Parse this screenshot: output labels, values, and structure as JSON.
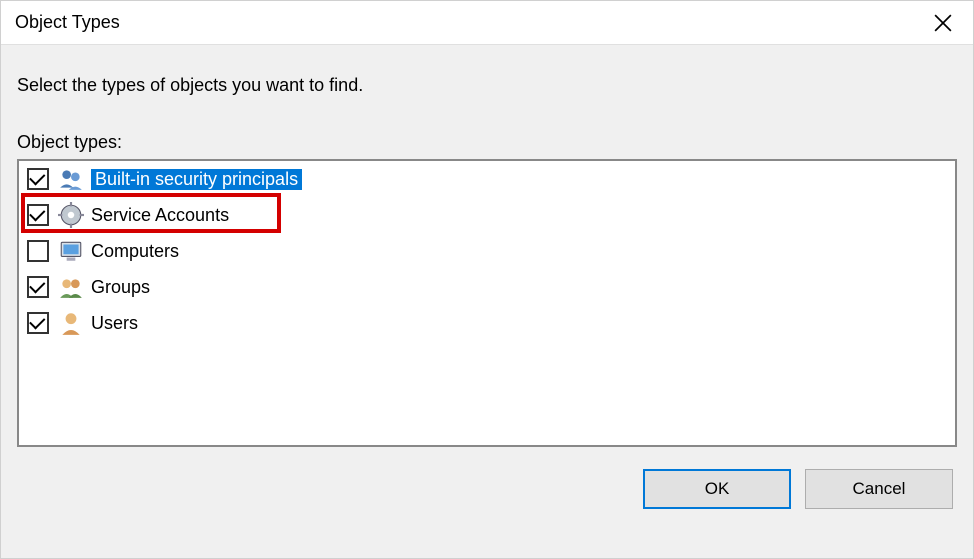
{
  "window": {
    "title": "Object Types"
  },
  "content": {
    "instruction": "Select the types of objects you want to find.",
    "section_label": "Object types:"
  },
  "items": [
    {
      "label": "Built-in security principals",
      "checked": true,
      "selected": true,
      "icon": "principals-icon"
    },
    {
      "label": "Service Accounts",
      "checked": true,
      "selected": false,
      "icon": "gear-icon",
      "highlighted": true
    },
    {
      "label": "Computers",
      "checked": false,
      "selected": false,
      "icon": "computer-icon"
    },
    {
      "label": "Groups",
      "checked": true,
      "selected": false,
      "icon": "groups-icon"
    },
    {
      "label": "Users",
      "checked": true,
      "selected": false,
      "icon": "user-icon"
    }
  ],
  "buttons": {
    "ok": "OK",
    "cancel": "Cancel"
  }
}
